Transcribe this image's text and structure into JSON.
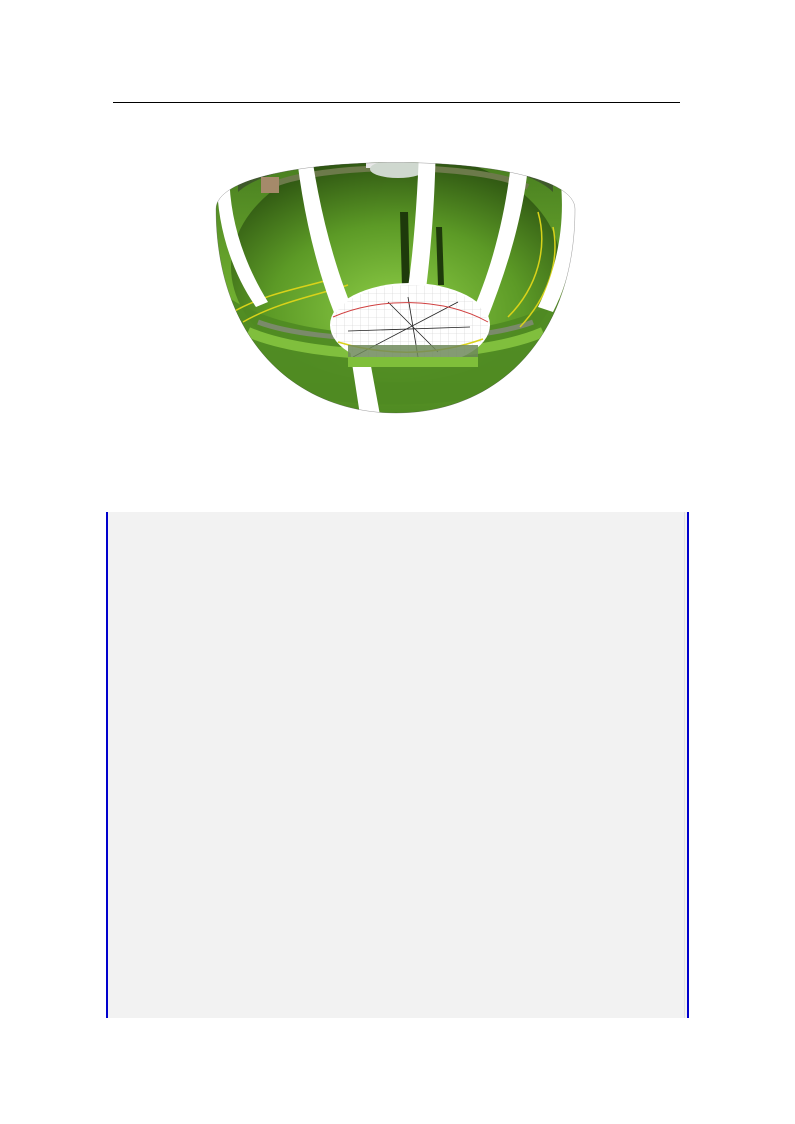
{
  "figure": {
    "subject": "fisheye-panorama-bowl",
    "colors": {
      "grass_dark": "#2f5a12",
      "grass_mid": "#4d8a1f",
      "grass_light": "#7fbf3a",
      "sky": "#f4f6f4",
      "trees": "#3f5a2a",
      "grid_line": "#b5b5b5",
      "sun_path": "#d9d21a",
      "marker_red": "#d04040"
    }
  },
  "frame": {
    "background": "#f2f2f2",
    "border_color": "#0000cc"
  }
}
